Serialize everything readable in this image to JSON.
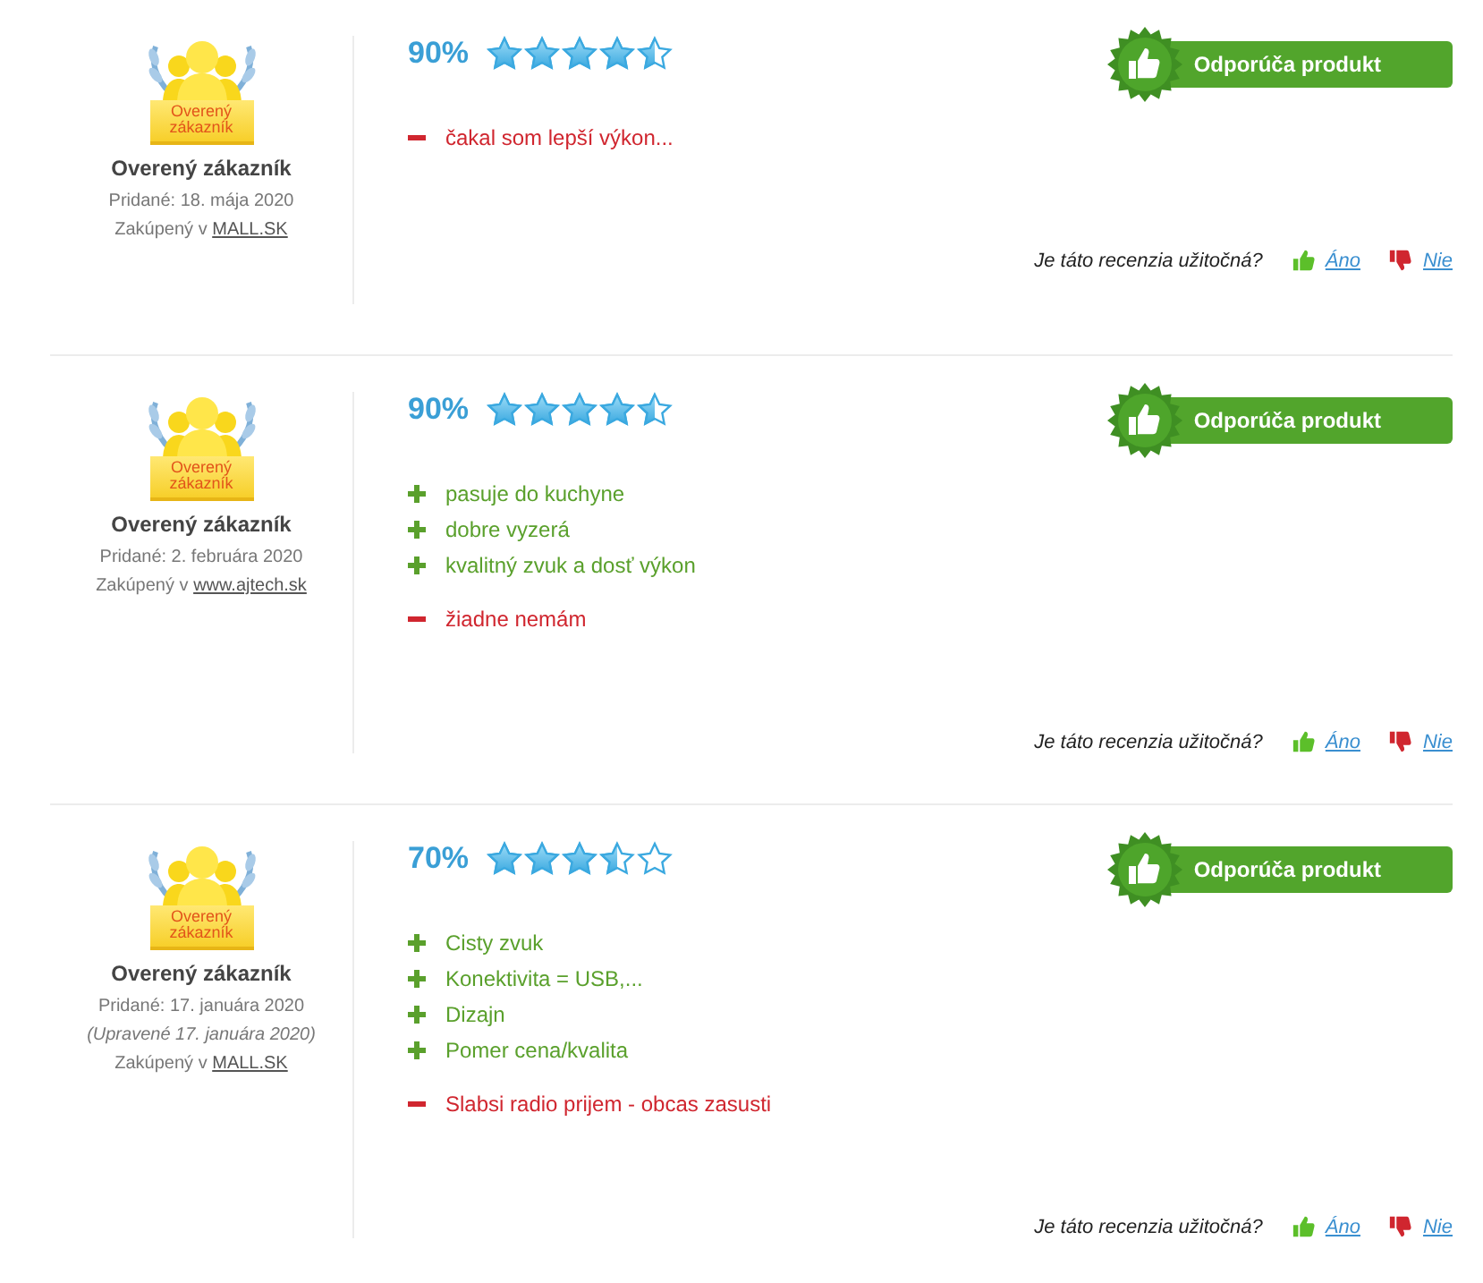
{
  "reviews": [
    {
      "reviewer": {
        "badge_label": "Overený zákazník",
        "name": "Overený zákazník",
        "added": "Pridané: 18. mája 2020",
        "purchased_prefix": "Zakúpený v",
        "shop": "MALL.SK"
      },
      "score": "90%",
      "stars": 4.5,
      "recommends": true,
      "recommend_label": "Odporúča produkt",
      "cons": [
        "čakal som lepší výkon..."
      ],
      "helpful": {
        "question": "Je táto recenzia užitočná?",
        "yes": "Áno",
        "no": "Nie"
      }
    },
    {
      "reviewer": {
        "badge_label": "Overený zákazník",
        "name": "Overený zákazník",
        "added": "Pridané: 2. februára 2020",
        "purchased_prefix": "Zakúpený v",
        "shop": "www.ajtech.sk"
      },
      "score": "90%",
      "stars": 4.5,
      "recommends": true,
      "recommend_label": "Odporúča produkt",
      "pros": [
        "pasuje do kuchyne",
        "dobre vyzerá",
        "kvalitný zvuk a dosť výkon"
      ],
      "cons": [
        "žiadne nemám"
      ],
      "helpful": {
        "question": "Je táto recenzia užitočná?",
        "yes": "Áno",
        "no": "Nie"
      }
    },
    {
      "reviewer": {
        "badge_label": "Overený zákazník",
        "name": "Overený zákazník",
        "added": "Pridané: 17. januára 2020",
        "edited": "(Upravené 17. januára 2020)",
        "purchased_prefix": "Zakúpený v",
        "shop": "MALL.SK"
      },
      "score": "70%",
      "stars": 3.5,
      "recommends": true,
      "recommend_label": "Odporúča produkt",
      "pros": [
        "Cisty zvuk",
        "Konektivita = USB,...",
        "Dizajn",
        "Pomer cena/kvalita"
      ],
      "cons": [
        "Slabsi radio prijem - obcas zasusti"
      ],
      "helpful": {
        "question": "Je táto recenzia užitočná?",
        "yes": "Áno",
        "no": "Nie"
      }
    }
  ]
}
